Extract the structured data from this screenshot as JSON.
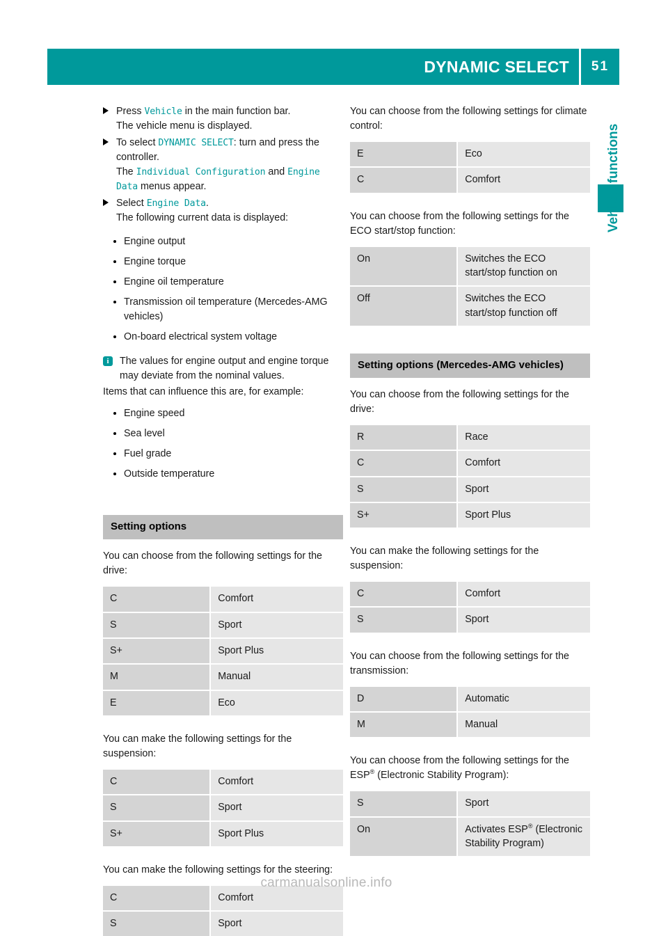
{
  "header": {
    "title": "DYNAMIC SELECT",
    "page_number": "51",
    "accent_color": "#00999b"
  },
  "side_tab": {
    "label": "Vehicle functions",
    "color": "#00999b"
  },
  "watermark": "carmanualsonline.info",
  "left_column": {
    "steps": [
      {
        "pre": "Press ",
        "mono1": "Vehicle",
        "mid": " in the main function bar.",
        "sub": "The vehicle menu is displayed."
      },
      {
        "pre": "To select ",
        "mono1": "DYNAMIC SELECT",
        "mid": ": turn and press the controller.",
        "sub_pre": "The ",
        "sub_mono1": "Individual Configuration",
        "sub_mid": " and ",
        "sub_mono2": "Engine Data",
        "sub_post": " menus appear."
      },
      {
        "pre": "Select ",
        "mono1": "Engine Data",
        "mid": ".",
        "sub": "The following current data is displayed:"
      }
    ],
    "data_list": [
      "Engine output",
      "Engine torque",
      "Engine oil temperature",
      "Transmission oil temperature (Mercedes-AMG vehicles)",
      "On-board electrical system voltage"
    ],
    "note": "The values for engine output and engine torque may deviate from the nominal values.",
    "note_follow": "Items that can influence this are, for example:",
    "influence_list": [
      "Engine speed",
      "Sea level",
      "Fuel grade",
      "Outside temperature"
    ],
    "section_heading": "Setting options",
    "drive_intro": "You can choose from the following settings for the drive:",
    "drive_table": [
      {
        "key": "C",
        "val": "Comfort"
      },
      {
        "key": "S",
        "val": "Sport"
      },
      {
        "key": "S+",
        "val": "Sport Plus"
      },
      {
        "key": "M",
        "val": "Manual"
      },
      {
        "key": "E",
        "val": "Eco"
      }
    ],
    "suspension_intro": "You can make the following settings for the suspension:",
    "suspension_table": [
      {
        "key": "C",
        "val": "Comfort"
      },
      {
        "key": "S",
        "val": "Sport"
      },
      {
        "key": "S+",
        "val": "Sport Plus"
      }
    ],
    "steering_intro": "You can make the following settings for the steering:",
    "steering_table": [
      {
        "key": "C",
        "val": "Comfort"
      },
      {
        "key": "S",
        "val": "Sport"
      }
    ]
  },
  "right_column": {
    "climate_intro": "You can choose from the following settings for climate control:",
    "climate_table": [
      {
        "key": "E",
        "val": "Eco"
      },
      {
        "key": "C",
        "val": "Comfort"
      }
    ],
    "eco_intro": "You can choose from the following settings for the ECO start/stop function:",
    "eco_table": [
      {
        "key": "On",
        "val": "Switches the ECO start/stop function on"
      },
      {
        "key": "Off",
        "val": "Switches the ECO start/stop function off"
      }
    ],
    "section_heading": "Setting options (Mercedes-AMG vehicles)",
    "amg_drive_intro": "You can choose from the following settings for the drive:",
    "amg_drive_table": [
      {
        "key": "R",
        "val": "Race"
      },
      {
        "key": "C",
        "val": "Comfort"
      },
      {
        "key": "S",
        "val": "Sport"
      },
      {
        "key": "S+",
        "val": "Sport Plus"
      }
    ],
    "amg_suspension_intro": "You can make the following settings for the suspension:",
    "amg_suspension_table": [
      {
        "key": "C",
        "val": "Comfort"
      },
      {
        "key": "S",
        "val": "Sport"
      }
    ],
    "amg_transmission_intro": "You can choose from the following settings for the transmission:",
    "amg_transmission_table": [
      {
        "key": "D",
        "val": "Automatic"
      },
      {
        "key": "M",
        "val": "Manual"
      }
    ],
    "esp_intro_pre": "You can choose from the following settings for the ESP",
    "esp_intro_post": " (Electronic Stability Program):",
    "esp_table": [
      {
        "key": "S",
        "val": "Sport",
        "reg": false
      },
      {
        "key": "On",
        "val_pre": "Activates ESP",
        "val_post": " (Electronic Stability Program)",
        "reg": true
      }
    ]
  }
}
